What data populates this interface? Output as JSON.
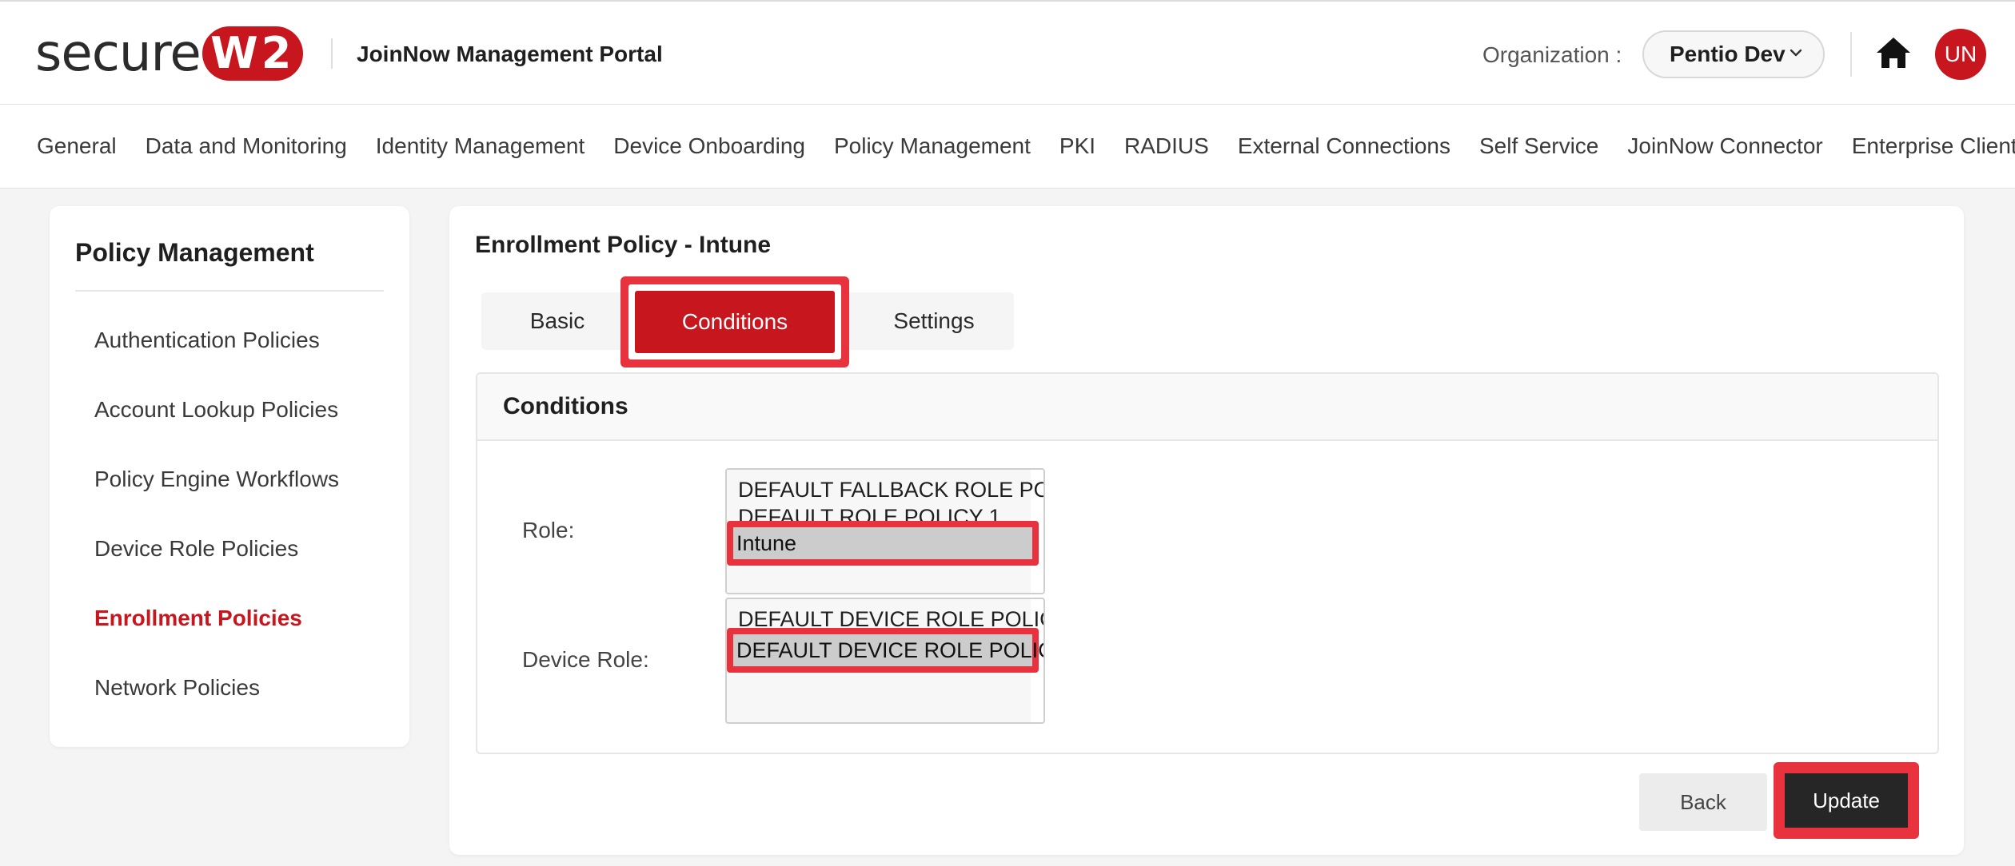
{
  "header": {
    "logo_text": "secure",
    "logo_badge": "W2",
    "portal_title": "JoinNow Management Portal",
    "org_label": "Organization :",
    "org_value": "Pentio Dev",
    "avatar_initials": "UN",
    "brand_color": "#c8161e",
    "icons": [
      "chevron-down-icon",
      "home-icon"
    ]
  },
  "nav": {
    "items": [
      "General",
      "Data and Monitoring",
      "Identity Management",
      "Device Onboarding",
      "Policy Management",
      "PKI",
      "RADIUS",
      "External Connections",
      "Self Service",
      "JoinNow Connector",
      "Enterprise Client"
    ]
  },
  "sidebar": {
    "title": "Policy Management",
    "items": [
      "Authentication Policies",
      "Account Lookup Policies",
      "Policy Engine Workflows",
      "Device Role Policies",
      "Enrollment Policies",
      "Network Policies"
    ],
    "active": "Enrollment Policies"
  },
  "main": {
    "title": "Enrollment Policy - Intune",
    "tabs": [
      "Basic",
      "Conditions",
      "Settings"
    ],
    "active_tab": "Conditions",
    "panel_title": "Conditions",
    "role": {
      "label": "Role:",
      "options": [
        "DEFAULT FALLBACK ROLE PO",
        "DEFAULT ROLE POLICY 1",
        "Intune"
      ],
      "selected": "Intune"
    },
    "device_role": {
      "label": "Device Role:",
      "options": [
        "DEFAULT DEVICE ROLE POLIC",
        "DEFAULT DEVICE ROLE POLIC"
      ],
      "selected": "DEFAULT DEVICE ROLE POLIC"
    },
    "back_label": "Back",
    "update_label": "Update",
    "highlight_color": "#e8323e"
  }
}
